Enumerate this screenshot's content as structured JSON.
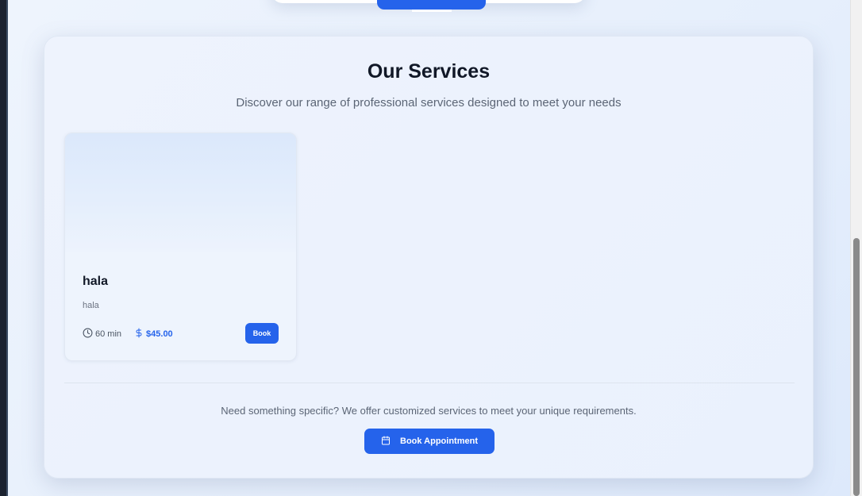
{
  "services": {
    "title": "Our Services",
    "subtitle": "Discover our range of professional services designed to meet your needs",
    "items": [
      {
        "name": "hala",
        "description": "hala",
        "duration": "60 min",
        "price": "$45.00",
        "book_label": "Book",
        "icons": {
          "duration": "clock-icon",
          "price": "dollar-icon"
        }
      }
    ],
    "custom_note": "Need something specific? We offer customized services to meet your unique requirements.",
    "cta_label": "Book Appointment",
    "cta_icon": "calendar-icon"
  },
  "colors": {
    "accent": "#2563eb",
    "title": "#111827",
    "muted": "#5b6575"
  }
}
